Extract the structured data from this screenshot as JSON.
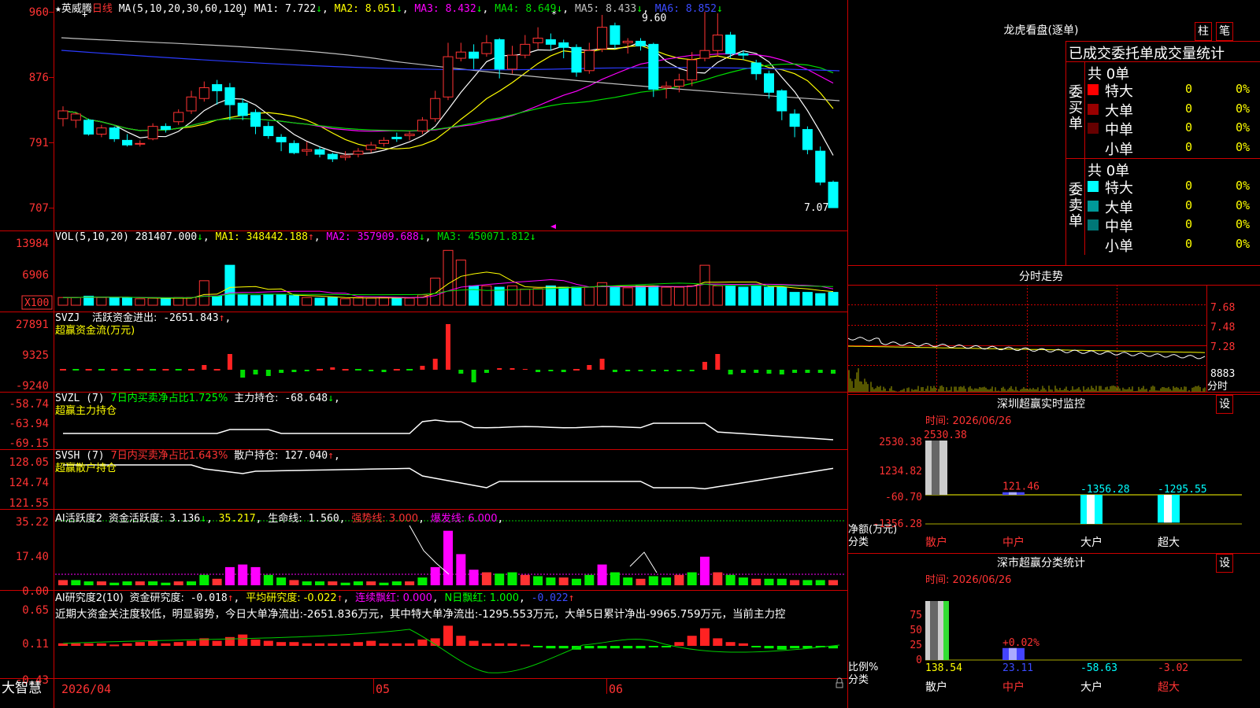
{
  "colors": {
    "up": "#ff3333",
    "down": "#00ffff",
    "frame": "#cc0000",
    "ma1": "#ffffff",
    "ma2": "#ffff00",
    "ma3": "#ff00ff",
    "ma4": "#00dd00",
    "ma5": "#c0c0c0",
    "ma6": "#2b3bff"
  },
  "header": {
    "star": "★",
    "stock": "英威腾",
    "period": "日线",
    "ma_params": "MA(5,10,20,30,60,120)",
    "ma": [
      {
        "label": "MA1:",
        "value": "7.722",
        "arrow": "↓"
      },
      {
        "label": "MA2:",
        "value": "8.051",
        "arrow": "↓"
      },
      {
        "label": "MA3:",
        "value": "8.432",
        "arrow": "↓"
      },
      {
        "label": "MA4:",
        "value": "8.649",
        "arrow": "↓"
      },
      {
        "label": "MA5:",
        "value": "8.433",
        "arrow": "↓"
      },
      {
        "label": "MA6:",
        "value": "8.852",
        "arrow": "↓"
      }
    ]
  },
  "price_axis": [
    "960",
    "876",
    "791",
    "707"
  ],
  "price_marks": {
    "high": "9.60",
    "low": "7.07"
  },
  "vol": {
    "params": "VOL(5,10,20)",
    "value": "281407.000",
    "ma": [
      {
        "label": "MA1:",
        "value": "348442.188",
        "arrow": "↑"
      },
      {
        "label": "MA2:",
        "value": "357909.688",
        "arrow": "↓"
      },
      {
        "label": "MA3:",
        "value": "450071.812",
        "arrow": "↓"
      }
    ],
    "axis": [
      "13984",
      "6906"
    ],
    "unit": "X100"
  },
  "svzj": {
    "name": "SVZJ",
    "label": "活跃资金进出:",
    "value": "-2651.843",
    "arrow": "↑",
    "sub": "超赢资金流(万元)",
    "axis": [
      "27891",
      "9325",
      "-9240"
    ]
  },
  "svzl": {
    "name": "SVZL",
    "param": "(7)",
    "label1": "7日内买卖净占比1.725%",
    "label2": "主力持仓:",
    "value": "-68.648",
    "arrow": "↓",
    "sub": "超赢主力持仓",
    "axis": [
      "-58.74",
      "-63.94",
      "-69.15"
    ]
  },
  "svsh": {
    "name": "SVSH",
    "param": "(7)",
    "label1": "7日内买卖净占比1.643%",
    "label2": "散户持仓:",
    "value": "127.040",
    "arrow": "↑",
    "sub": "超赢散户持仓",
    "axis": [
      "128.05",
      "124.74",
      "121.55"
    ]
  },
  "ai1": {
    "name": "AI活跃度2",
    "label": "资金活跃度:",
    "value": "3.136",
    "arrow": "↓",
    "v2": "35.217",
    "label3": "生命线:",
    "v3": "1.560",
    "label4": "强势线:",
    "v4": "3.000",
    "label5": "爆发线:",
    "v5": "6.000",
    "axis": [
      "35.22",
      "17.40",
      "0.00"
    ]
  },
  "ai2": {
    "name": "AI研究度2(10)",
    "label": "资金研究度:",
    "value": "-0.018",
    "arrow": "↑",
    "label2": "平均研究度:",
    "v2": "-0.022",
    "label3": "连续飘红:",
    "v3": "0.000",
    "label4": "N日飘红:",
    "v4": "1.000",
    "v5": "-0.022",
    "axis": [
      "0.65",
      "0.11",
      "-0.43"
    ],
    "comment": "近期大资金关注度较低，明显弱势，今日大单净流出:-2651.836万元，其中特大单净流出:-1295.553万元，大单5日累计净出-9965.759万元，当前主力控"
  },
  "footer": {
    "brand": "大智慧",
    "date": "2026/04",
    "month1": "05",
    "month2": "06"
  },
  "lhb": {
    "title": "龙虎看盘(逐单)",
    "btn1": "柱",
    "btn2": "笔",
    "subtitle": "已成交委托单成交量统计",
    "buy": {
      "side": "委买单",
      "total": "共 0单",
      "rows": [
        {
          "label": "特大",
          "value": "0",
          "pct": "0%",
          "color": "#ff0000"
        },
        {
          "label": "大单",
          "value": "0",
          "pct": "0%",
          "color": "#990000"
        },
        {
          "label": "中单",
          "value": "0",
          "pct": "0%",
          "color": "#660000"
        },
        {
          "label": "小单",
          "value": "0",
          "pct": "0%",
          "color": "#000000"
        }
      ]
    },
    "sell": {
      "side": "委卖单",
      "total": "共 0单",
      "rows": [
        {
          "label": "特大",
          "value": "0",
          "pct": "0%",
          "color": "#00ffff"
        },
        {
          "label": "大单",
          "value": "0",
          "pct": "0%",
          "color": "#009999"
        },
        {
          "label": "中单",
          "value": "0",
          "pct": "0%",
          "color": "#007777"
        },
        {
          "label": "小单",
          "value": "0",
          "pct": "0%",
          "color": "#000000"
        }
      ]
    }
  },
  "fenshi": {
    "title": "分时走势",
    "axis": [
      "7.68",
      "7.48",
      "7.28"
    ],
    "vol": "8883",
    "unit": "分时"
  },
  "sz_monitor": {
    "title": "深圳超赢实时监控",
    "btn": "设",
    "time": "时间: 2026/06/26",
    "axis": [
      "2530.38",
      "1234.82",
      "-60.70",
      "-1356.28"
    ],
    "ylabel": "净额(万元)",
    "xlabel": "分类",
    "cats": [
      "散户",
      "中户",
      "大户",
      "超大"
    ],
    "values": [
      "2530.38",
      "121.46",
      "-1356.28",
      "-1295.55"
    ]
  },
  "sz_class": {
    "title": "深市超赢分类统计",
    "btn": "设",
    "time": "时间: 2026/06/26",
    "axis": [
      "75",
      "50",
      "25",
      "0"
    ],
    "ylabel": "比例%",
    "xlabel": "分类",
    "note": "+0.02%",
    "cats": [
      "散户",
      "中户",
      "大户",
      "超大"
    ],
    "values": [
      "138.54",
      "23.11",
      "-58.63",
      "-3.02"
    ]
  }
}
